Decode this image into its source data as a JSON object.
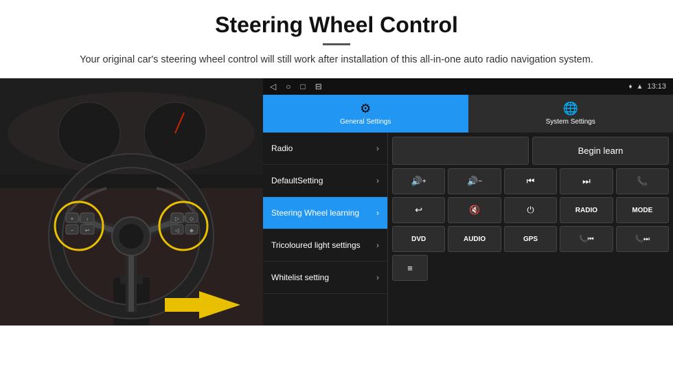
{
  "header": {
    "title": "Steering Wheel Control",
    "description": "Your original car's steering wheel control will still work after installation of this all-in-one auto radio navigation system."
  },
  "status_bar": {
    "back_icon": "◁",
    "home_icon": "○",
    "recent_icon": "□",
    "menu_icon": "⊟",
    "signal_icon": "♦",
    "wifi_icon": "▲",
    "time": "13:13"
  },
  "tabs": [
    {
      "label": "General Settings",
      "active": true
    },
    {
      "label": "System Settings",
      "active": false
    }
  ],
  "menu_items": [
    {
      "label": "Radio",
      "active": false
    },
    {
      "label": "DefaultSetting",
      "active": false
    },
    {
      "label": "Steering Wheel learning",
      "active": true
    },
    {
      "label": "Tricoloured light settings",
      "active": false
    },
    {
      "label": "Whitelist setting",
      "active": false
    }
  ],
  "begin_learn_label": "Begin learn",
  "control_buttons": {
    "row1": [
      "🔊+",
      "🔊−",
      "⏮",
      "⏭",
      "📞"
    ],
    "row2": [
      "↩",
      "🔊✕",
      "⏻",
      "RADIO",
      "MODE"
    ],
    "row3": [
      "DVD",
      "AUDIO",
      "GPS",
      "📞⏮",
      "📞⏭"
    ],
    "row4": [
      "≡"
    ]
  }
}
